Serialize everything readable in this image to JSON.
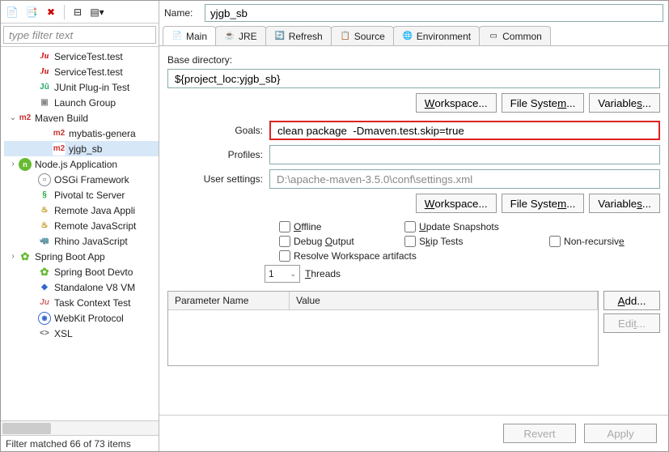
{
  "filter": {
    "placeholder": "type filter text"
  },
  "tree": {
    "items": [
      {
        "twisty": "",
        "lvl": 1,
        "icon": "ju",
        "label": "ServiceTest.test"
      },
      {
        "twisty": "",
        "lvl": 1,
        "icon": "ju",
        "label": "ServiceTest.test"
      },
      {
        "twisty": "",
        "lvl": 1,
        "icon": "junit",
        "label": "JUnit Plug-in Test"
      },
      {
        "twisty": "",
        "lvl": 1,
        "icon": "launch",
        "label": "Launch Group"
      },
      {
        "twisty": "v",
        "lvl": 0,
        "icon": "m2",
        "label": "Maven Build"
      },
      {
        "twisty": "",
        "lvl": 2,
        "icon": "m2",
        "label": "mybatis-genera"
      },
      {
        "twisty": "",
        "lvl": 2,
        "icon": "m2",
        "label": "yjgb_sb",
        "selected": true
      },
      {
        "twisty": ">",
        "lvl": 0,
        "icon": "node",
        "label": "Node.js Application"
      },
      {
        "twisty": "",
        "lvl": 1,
        "icon": "osgi",
        "label": "OSGi Framework"
      },
      {
        "twisty": "",
        "lvl": 1,
        "icon": "pivotal",
        "label": "Pivotal tc Server"
      },
      {
        "twisty": "",
        "lvl": 1,
        "icon": "java",
        "label": "Remote Java Appli"
      },
      {
        "twisty": "",
        "lvl": 1,
        "icon": "js",
        "label": "Remote JavaScript"
      },
      {
        "twisty": "",
        "lvl": 1,
        "icon": "rhino",
        "label": "Rhino JavaScript"
      },
      {
        "twisty": ">",
        "lvl": 0,
        "icon": "spring",
        "label": "Spring Boot App"
      },
      {
        "twisty": "",
        "lvl": 1,
        "icon": "spring",
        "label": "Spring Boot Devto"
      },
      {
        "twisty": "",
        "lvl": 1,
        "icon": "v8",
        "label": "Standalone V8 VM"
      },
      {
        "twisty": "",
        "lvl": 1,
        "icon": "task",
        "label": "Task Context Test"
      },
      {
        "twisty": "",
        "lvl": 1,
        "icon": "webkit",
        "label": "WebKit Protocol"
      },
      {
        "twisty": "",
        "lvl": 1,
        "icon": "xsl",
        "label": "XSL"
      }
    ]
  },
  "status": "Filter matched 66 of 73 items",
  "form": {
    "name_label": "Name:",
    "name_value": "yjgb_sb"
  },
  "tabs": [
    {
      "label": "Main"
    },
    {
      "label": "JRE"
    },
    {
      "label": "Refresh"
    },
    {
      "label": "Source"
    },
    {
      "label": "Environment"
    },
    {
      "label": "Common"
    }
  ],
  "main": {
    "base_dir_label": "Base directory:",
    "base_dir_value": "${project_loc:yjgb_sb}",
    "workspace_btn": "Workspace...",
    "filesystem_btn": "File System...",
    "variables_btn": "Variables...",
    "goals_label": "Goals:",
    "goals_value": "clean package  -Dmaven.test.skip=true",
    "profiles_label": "Profiles:",
    "profiles_value": "",
    "user_settings_label": "User settings:",
    "user_settings_value": "D:\\apache-maven-3.5.0\\conf\\settings.xml",
    "chk_offline": "Offline",
    "chk_update": "Update Snapshots",
    "chk_debug": "Debug Output",
    "chk_skip": "Skip Tests",
    "chk_nonrec": "Non-recursive",
    "chk_resolve": "Resolve Workspace artifacts",
    "threads_value": "1",
    "threads_label": "Threads",
    "param_name_hdr": "Parameter Name",
    "param_value_hdr": "Value",
    "add_btn": "Add...",
    "edit_btn": "Edit..."
  },
  "footer": {
    "revert": "Revert",
    "apply": "Apply"
  },
  "icon_text": {
    "ju": "Ju",
    "junit": "Jû",
    "launch": "▣",
    "m2": "m2",
    "node": "n",
    "osgi": "○",
    "pivotal": "§",
    "java": "♨",
    "js": "♨",
    "rhino": "🦏",
    "spring": "✿",
    "v8": "◆",
    "task": "Ju",
    "webkit": "◉",
    "xsl": "<>"
  }
}
